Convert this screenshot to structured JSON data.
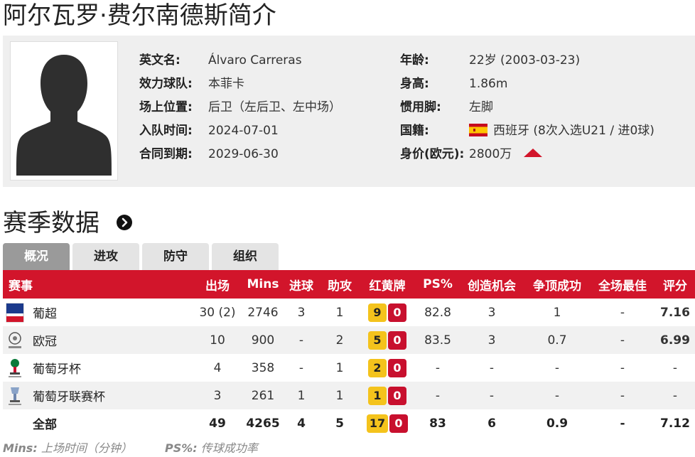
{
  "page": {
    "title": "阿尔瓦罗·费尔南德斯简介"
  },
  "profile": {
    "left": [
      {
        "label": "英文名:",
        "value": "Álvaro Carreras"
      },
      {
        "label": "效力球队:",
        "value": "本菲卡"
      },
      {
        "label": "场上位置:",
        "value": "后卫（左后卫、左中场）"
      },
      {
        "label": "入队时间:",
        "value": "2024-07-01"
      },
      {
        "label": "合同到期:",
        "value": "2029-06-30"
      }
    ],
    "right": [
      {
        "label": "年龄:",
        "value": "22岁 (2003-03-23)"
      },
      {
        "label": "身高:",
        "value": "1.86m"
      },
      {
        "label": "惯用脚:",
        "value": "左脚"
      },
      {
        "label": "国籍:",
        "value": "西班牙 (8次入选U21 / 进0球)"
      },
      {
        "label": "身价(欧元):",
        "value": "2800万"
      }
    ],
    "value_trend": "up",
    "value_trend_color": "#d2152b"
  },
  "section": {
    "title": "赛季数据",
    "arrow_icon": "arrow-right-circle-icon"
  },
  "tabs": [
    {
      "label": "概况",
      "active": true
    },
    {
      "label": "进攻",
      "active": false
    },
    {
      "label": "防守",
      "active": false
    },
    {
      "label": "组织",
      "active": false
    }
  ],
  "table": {
    "headers": {
      "comp": "赛事",
      "apps": "出场",
      "mins": "Mins",
      "goals": "进球",
      "assists": "助攻",
      "cards": "红黄牌",
      "ps": "PS%",
      "chances": "创造机会",
      "aerials": "争顶成功",
      "motm": "全场最佳",
      "rating": "评分"
    },
    "rows": [
      {
        "comp": "葡超",
        "apps": "30 (2)",
        "mins": "2746",
        "goals": "3",
        "assists": "1",
        "yellow": "9",
        "red": "0",
        "ps": "82.8",
        "chances": "3",
        "aerials": "1",
        "motm": "-",
        "rating": "7.16"
      },
      {
        "comp": "欧冠",
        "apps": "10",
        "mins": "900",
        "goals": "-",
        "assists": "2",
        "yellow": "5",
        "red": "0",
        "ps": "83.5",
        "chances": "3",
        "aerials": "0.7",
        "motm": "-",
        "rating": "6.99"
      },
      {
        "comp": "葡萄牙杯",
        "apps": "4",
        "mins": "358",
        "goals": "-",
        "assists": "1",
        "yellow": "2",
        "red": "0",
        "ps": "-",
        "chances": "-",
        "aerials": "-",
        "motm": "-",
        "rating": "-"
      },
      {
        "comp": "葡萄牙联赛杯",
        "apps": "3",
        "mins": "261",
        "goals": "1",
        "assists": "1",
        "yellow": "1",
        "red": "0",
        "ps": "-",
        "chances": "-",
        "aerials": "-",
        "motm": "-",
        "rating": "-"
      }
    ],
    "total": {
      "comp": "全部",
      "apps": "49",
      "mins": "4265",
      "goals": "4",
      "assists": "5",
      "yellow": "17",
      "red": "0",
      "ps": "83",
      "chances": "6",
      "aerials": "0.9",
      "motm": "-",
      "rating": "7.12"
    }
  },
  "footnotes": [
    {
      "key": "Mins:",
      "text": "上场时间（分钟）"
    },
    {
      "key": "PS%:",
      "text": "传球成功率"
    }
  ],
  "colors": {
    "header_bg": "#d2152b",
    "rating": "#e8641a",
    "yellow_card": "#f4c31c",
    "red_card": "#c8102e"
  }
}
